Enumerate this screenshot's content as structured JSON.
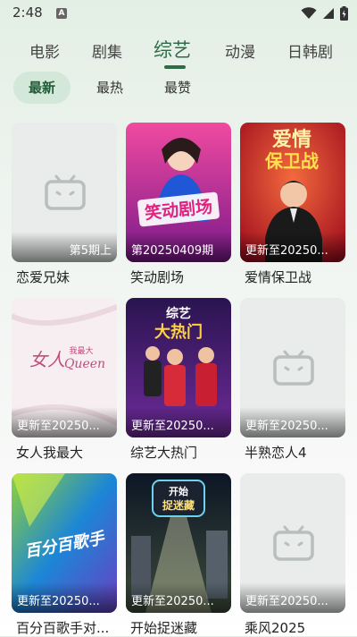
{
  "status_bar": {
    "time": "2:48",
    "indicator": "A"
  },
  "top_tabs": [
    "电影",
    "剧集",
    "综艺",
    "动漫",
    "日韩剧"
  ],
  "active_top_tab": "综艺",
  "sub_tabs": [
    "最新",
    "最热",
    "最赞"
  ],
  "active_sub_tab": "最新",
  "cards": [
    {
      "title": "恋爱兄妹",
      "badge": "第5期上",
      "placeholder": true
    },
    {
      "title": "笑动剧场",
      "badge": "第20250409期",
      "poster_text": "笑动剧场",
      "poster_colors": [
        "#e0338a",
        "#8e1a8f"
      ]
    },
    {
      "title": "爱情保卫战",
      "badge": "更新至20250...",
      "poster_text": "爱情保卫战",
      "poster_colors": [
        "#b81b26",
        "#f0563a"
      ]
    },
    {
      "title": "女人我最大",
      "badge": "更新至20250...",
      "poster_text": "女人我最大 Queen",
      "poster_colors": [
        "#f7f1f3",
        "#e9dfe4"
      ]
    },
    {
      "title": "综艺大热门",
      "badge": "更新至20250...",
      "poster_text": "综艺大热门",
      "poster_colors": [
        "#3b1d63",
        "#7a2aa0"
      ]
    },
    {
      "title": "半熟恋人4",
      "badge": "更新至20250...",
      "placeholder": true
    },
    {
      "title": "百分百歌手对...",
      "badge": "更新至20250...",
      "poster_text": "百分百歌手",
      "poster_colors": [
        "#1d7fd0",
        "#8bd13a"
      ]
    },
    {
      "title": "开始捉迷藏",
      "badge": "更新至20250...",
      "poster_text": "开始捉迷藏",
      "poster_colors": [
        "#0f1a2a",
        "#3f5a3a"
      ]
    },
    {
      "title": "乘风2025",
      "badge": "更新至20250...",
      "placeholder": true
    }
  ],
  "colors": {
    "accent": "#2e6b46",
    "chip_bg": "#d4e8d9"
  },
  "icons": [
    "wifi-icon",
    "signal-icon",
    "battery-icon",
    "tv-placeholder-icon"
  ]
}
